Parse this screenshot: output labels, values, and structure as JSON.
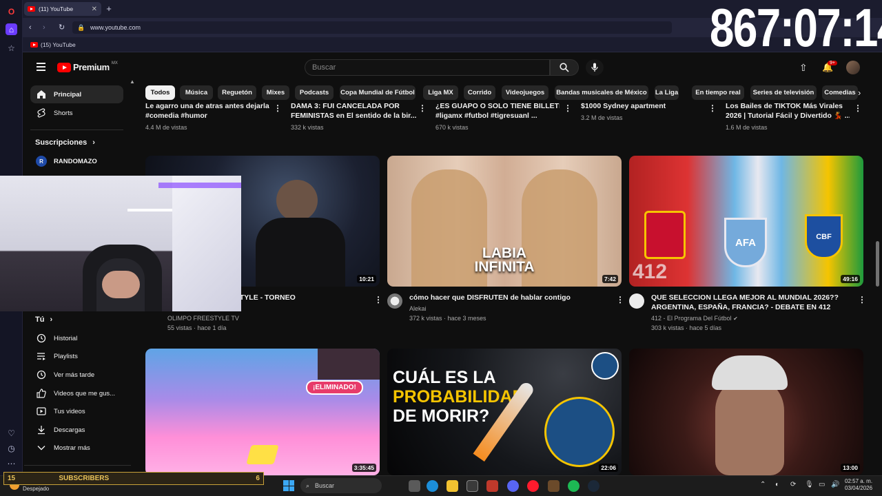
{
  "browser": {
    "active_tab_title": "(11) YouTube",
    "url": "www.youtube.com",
    "bookmark_label": "(15) YouTube"
  },
  "overlay": {
    "timer": "867:07:14",
    "sub_count_left": "15",
    "sub_label": "SUBSCRIBERS",
    "sub_count_right": "6",
    "weather_text": "Despejado"
  },
  "youtube": {
    "logo_text": "Premium",
    "region_badge": "MX",
    "search_placeholder": "Buscar",
    "notification_badge": "9+",
    "chips": [
      "Todos",
      "Música",
      "Reguetón",
      "Mixes",
      "Podcasts",
      "Copa Mundial de Fútbol",
      "Liga MX",
      "Corrido",
      "Videojuegos",
      "Bandas musicales de México",
      "La Liga",
      "En tiempo real",
      "Series de televisión",
      "Comedias"
    ],
    "sidebar": {
      "top": [
        {
          "label": "Principal",
          "icon": "home-icon"
        },
        {
          "label": "Shorts",
          "icon": "shorts-icon"
        }
      ],
      "subscriptions_title": "Suscripciones",
      "subscriptions": [
        {
          "label": "RANDOMAZO"
        }
      ],
      "you_title": "Tú",
      "you_items": [
        {
          "label": "Historial",
          "icon": "history-icon"
        },
        {
          "label": "Playlists",
          "icon": "playlists-icon"
        },
        {
          "label": "Ver más tarde",
          "icon": "watch-later-icon"
        },
        {
          "label": "Videos que me gus...",
          "icon": "like-icon"
        },
        {
          "label": "Tus videos",
          "icon": "your-videos-icon"
        },
        {
          "label": "Descargas",
          "icon": "download-icon"
        },
        {
          "label": "Mostrar más",
          "icon": "chevron-down-icon"
        }
      ]
    },
    "partial_row": [
      {
        "title1": "Le agarro una de atras antes dejarla",
        "title2": "#comedia #humor",
        "meta": "4.4 M de vistas"
      },
      {
        "title1": "DAMA 3: FUI CANCELADA POR",
        "title2": "FEMINISTAS en El sentido de la bir...",
        "meta": "332 k vistas"
      },
      {
        "title1": "¿ES GUAPO O SOLO TIENE BILLETE?",
        "title2": "#ligamx #futbol #tigresuanl ...",
        "meta": "670 k vistas"
      },
      {
        "title1": "$1000 Sydney apartment",
        "title2": "",
        "meta": "3.2 M de vistas"
      },
      {
        "title1": "Los Bailes de TIKTOK Más Virales",
        "title2": "2026 | Tutorial Fácil y Divertido 💃 ...",
        "meta": "1.6 M de vistas"
      }
    ],
    "row1": [
      {
        "title1": "AL || OLIMPO FREESTYLE - TORNEO",
        "title2": "",
        "channel": "OLIMPO FREESTYLE TV",
        "stats": "55 vistas · hace 1 día",
        "duration": "10:21"
      },
      {
        "title1": "cómo hacer que DISFRUTEN de hablar contigo",
        "title2": "",
        "channel": "Alekai",
        "stats": "372 k vistas · hace 3 meses",
        "duration": "7:42",
        "thumb_text1": "LABIA",
        "thumb_text2": "INFINITA"
      },
      {
        "title1": "QUE SELECCION LLEGA MEJOR AL MUNDIAL 2026??",
        "title2": "ARGENTINA, ESPAÑA, FRANCIA? - DEBATE EN 412",
        "channel": "412 - El Programa Del Fútbol",
        "stats": "303 k vistas · hace 5 días",
        "duration": "49:16",
        "thumb_text": "412"
      }
    ],
    "row2": [
      {
        "duration": "3:35:45",
        "thumb_text": "¡ELIMINADO!"
      },
      {
        "duration": "22:06",
        "thumb_text1": "CUÁL ES LA",
        "thumb_text2": "PROBABILIDAD",
        "thumb_text3": "DE MORIR?"
      },
      {
        "duration": "13:00"
      }
    ]
  },
  "taskbar": {
    "search_label": "Buscar",
    "time": "02:57 a. m.",
    "date": "03/04/2026"
  }
}
